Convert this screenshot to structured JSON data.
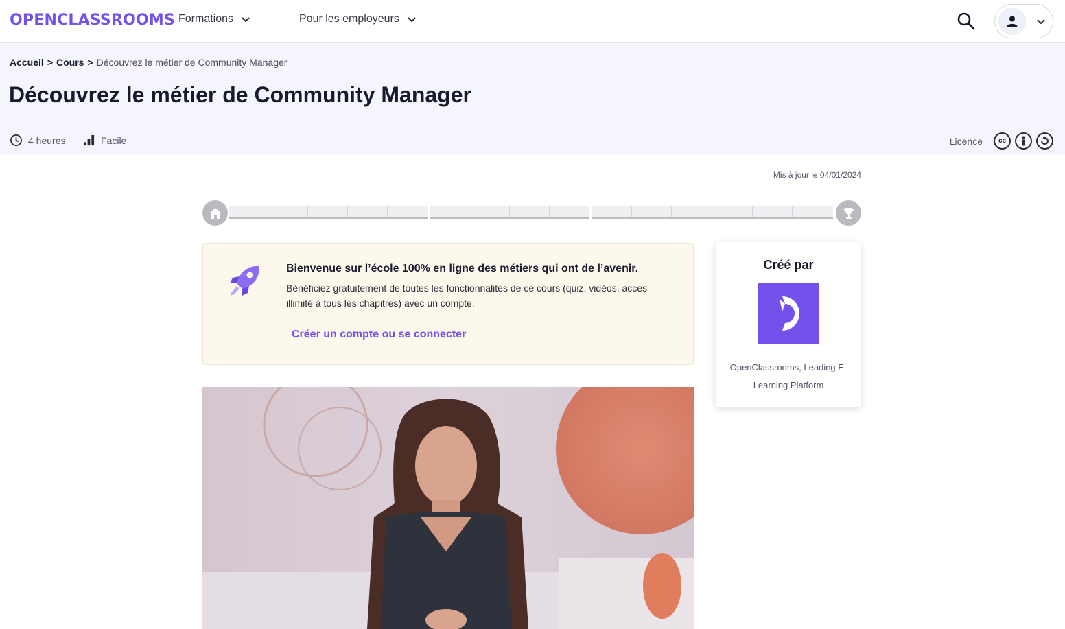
{
  "nav": {
    "logo": "OPENCLASSROOMS",
    "formations": "Formations",
    "employeurs": "Pour les employeurs"
  },
  "breadcrumb": {
    "home": "Accueil",
    "courses": "Cours",
    "current": "Découvrez le métier de Community Manager",
    "sep": ">"
  },
  "course": {
    "title": "Découvrez le métier de Community Manager",
    "duration": "4 heures",
    "level": "Facile",
    "licence_label": "Licence",
    "updated": "Mis à jour le 04/01/2024"
  },
  "progress": {
    "parts": [
      5,
      4,
      6
    ],
    "completed_fraction": 0
  },
  "welcome": {
    "title": "Bienvenue sur l’école 100% en ligne des métiers qui ont de l’avenir.",
    "body": "Bénéficiez gratuitement de toutes les fonctionnalités de ce cours (quiz, vidéos, accès illimité à tous les chapitres) avec un compte.",
    "cta": "Créer un compte ou se connecter"
  },
  "author": {
    "heading": "Créé par",
    "name": "OpenClassrooms, Leading E-Learning Platform"
  },
  "colors": {
    "brand": "#7451eb",
    "header_bg": "#f5f5fd",
    "welcome_bg": "#fcf8ec"
  },
  "icons": [
    "chevron-down-icon",
    "search-icon",
    "user-icon",
    "clock-icon",
    "level-bars-icon",
    "cc-icon",
    "cc-by-icon",
    "cc-sa-icon",
    "home-icon",
    "trophy-icon",
    "rocket-icon"
  ]
}
